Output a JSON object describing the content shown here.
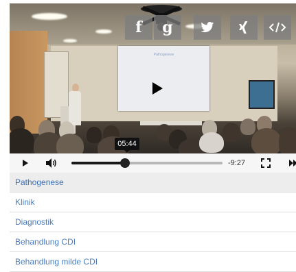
{
  "player": {
    "current_time_tooltip": "05:44",
    "remaining_time": "-9:27",
    "progress": 0.354,
    "slide_title": "Pathogenese"
  },
  "share": {
    "buttons": [
      {
        "icon": "facebook-icon",
        "glyph": "f"
      },
      {
        "icon": "google-plus-icon",
        "glyph": "g"
      },
      {
        "icon": "twitter-icon",
        "glyph": "twitter"
      },
      {
        "icon": "xing-icon",
        "glyph": "xing"
      },
      {
        "icon": "embed-icon",
        "glyph": "</>"
      }
    ]
  },
  "controls": {
    "icons": [
      "play-icon",
      "volume-icon",
      "fullscreen-icon",
      "next-icon"
    ]
  },
  "chapters": [
    {
      "label": "Pathogenese",
      "active": true
    },
    {
      "label": "Klinik",
      "active": false
    },
    {
      "label": "Diagnostik",
      "active": false
    },
    {
      "label": "Behandlung CDI",
      "active": false
    },
    {
      "label": "Behandlung milde CDI",
      "active": false
    }
  ],
  "colors": {
    "link": "#4a7dbf",
    "active_row": "#ededed",
    "control_bar": "#f6f6f6"
  }
}
